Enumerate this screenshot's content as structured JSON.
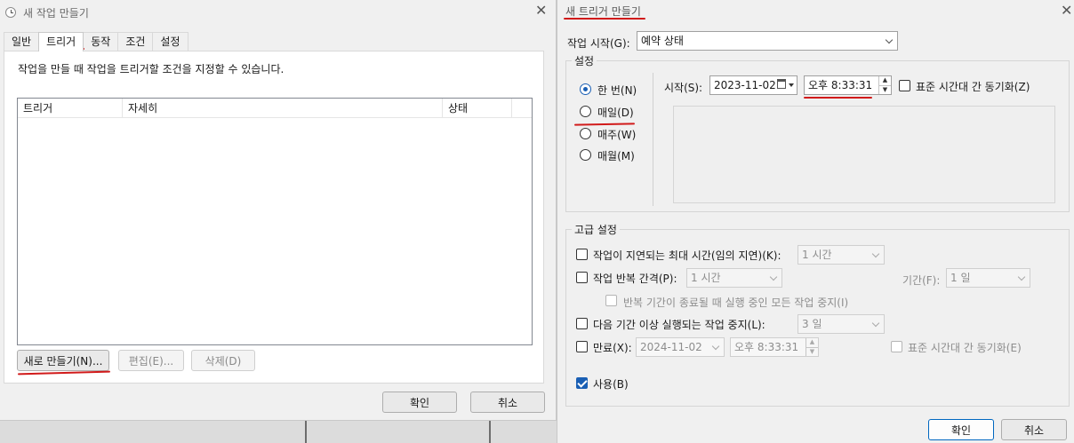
{
  "left_dialog": {
    "title": "새 작업 만들기",
    "tabs": [
      "일반",
      "트리거",
      "동작",
      "조건",
      "설정"
    ],
    "active_tab": "트리거",
    "description": "작업을 만들 때 작업을 트리거할 조건을 지정할 수 있습니다.",
    "columns": [
      "트리거",
      "자세히",
      "상태"
    ],
    "buttons": {
      "new": "새로 만들기(N)...",
      "edit": "편집(E)...",
      "delete": "삭제(D)"
    },
    "ok": "확인",
    "cancel": "취소"
  },
  "right_dialog": {
    "title": "새 트리거 만들기",
    "begin_label": "작업 시작(G):",
    "begin_value": "예약 상태",
    "settings_title": "설정",
    "options": [
      "한 번(N)",
      "매일(D)",
      "매주(W)",
      "매월(M)"
    ],
    "selected_option": "한 번(N)",
    "start_label": "시작(S):",
    "start_date": "2023-11-02",
    "start_time": "오후   8:33:31",
    "sync_tz": "표준 시간대 간 동기화(Z)",
    "advanced_title": "고급 설정",
    "delay_label": "작업이 지연되는 최대 시간(임의 지연)(K):",
    "delay_value": "1 시간",
    "repeat_label": "작업 반복 간격(P):",
    "repeat_value": "1 시간",
    "duration_label": "기간(F):",
    "duration_value": "1 일",
    "stop_all_label": "반복 기간이 종료될 때 실행 중인 모든 작업 중지(I)",
    "stop_longer_label": "다음 기간 이상 실행되는 작업 중지(L):",
    "stop_longer_value": "3 일",
    "expire_label": "만료(X):",
    "expire_date": "2024-11-02",
    "expire_time": "오후   8:33:31",
    "expire_sync": "표준 시간대 간 동기화(E)",
    "enabled_label": "사용(B)",
    "ok": "확인",
    "cancel": "취소"
  },
  "colors": {
    "annotation_red": "#d11a1a",
    "accent": "#1a5fb4"
  }
}
